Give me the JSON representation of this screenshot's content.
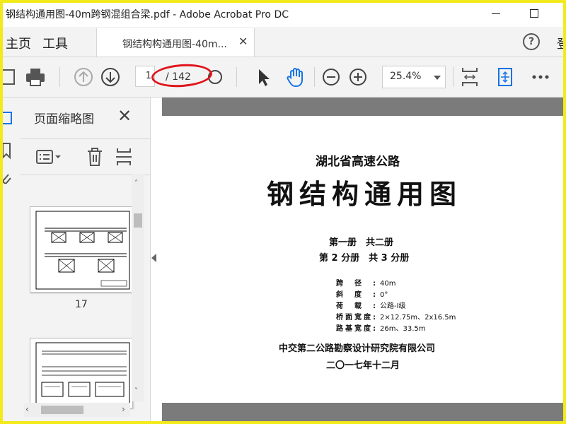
{
  "window": {
    "title": "钢结构通用图-40m跨钢混组合梁.pdf - Adobe Acrobat Pro DC"
  },
  "tabs": {
    "home": "主页",
    "tools": "工具",
    "doc": "钢结构构通用图-40m..."
  },
  "header": {
    "login": "登"
  },
  "toolbar": {
    "page_current": "1",
    "page_total": "/ 142",
    "zoom": "25.4%"
  },
  "thumbnail_panel": {
    "title": "页面缩略图",
    "thumbnails": [
      {
        "label": "17"
      },
      {
        "label": ""
      }
    ]
  },
  "document": {
    "line1": "湖北省高速公路",
    "main_title": "钢结构通用图",
    "volume": "第一册　共二册",
    "part": "第 2 分册　共 3 分册",
    "specs": [
      {
        "key": "跨径:",
        "value": "40m"
      },
      {
        "key": "斜度:",
        "value": "0°"
      },
      {
        "key": "荷载:",
        "value": "公路-Ⅰ级"
      },
      {
        "key": "桥面宽度:",
        "value": "2×12.75m、2x16.5m"
      },
      {
        "key": "路基宽度:",
        "value": "26m、33.5m"
      }
    ],
    "organization": "中交第二公路勘察设计研究院有限公司",
    "date": "二〇一七年十二月"
  },
  "colors": {
    "frame": "#f2ea1a",
    "annotation": "#e0141a",
    "hand_tool": "#1473e6"
  }
}
